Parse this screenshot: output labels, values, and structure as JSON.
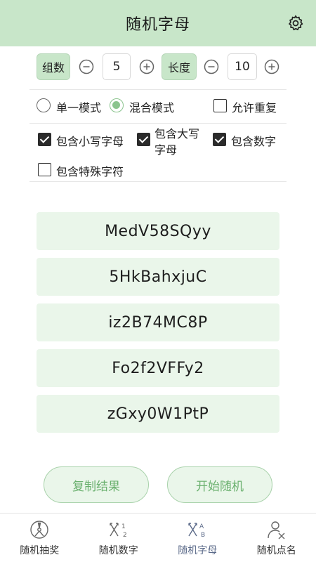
{
  "header": {
    "title": "随机字母",
    "settings_icon": "gear-icon"
  },
  "controls": {
    "groups_label": "组数",
    "groups_value": "5",
    "length_label": "长度",
    "length_value": "10",
    "minus_icon": "minus-circle-icon",
    "plus_icon": "plus-circle-icon"
  },
  "modes": [
    {
      "label": "单一模式",
      "selected": false
    },
    {
      "label": "混合模式",
      "selected": true
    }
  ],
  "allow_repeat": {
    "label": "允许重复",
    "checked": false
  },
  "options": [
    {
      "label": "包含小写字母",
      "checked": true
    },
    {
      "label_line1": "包含大写",
      "label_line2": "字母",
      "checked": true
    },
    {
      "label": "包含数字",
      "checked": true
    },
    {
      "label": "包含特殊字符",
      "checked": false
    }
  ],
  "results": [
    "MedV58SQyy",
    "5HkBahxjuC",
    "iz2B74MC8P",
    "Fo2f2VFFy2",
    "zGxy0W1PtP"
  ],
  "actions": {
    "copy_label": "复制结果",
    "start_label": "开始随机"
  },
  "tabs": [
    {
      "label": "随机抽奖",
      "icon": "wheel-icon",
      "active": false
    },
    {
      "label": "随机数字",
      "icon": "number-shuffle-icon",
      "active": false
    },
    {
      "label": "随机字母",
      "icon": "letter-shuffle-icon",
      "active": true
    },
    {
      "label": "随机点名",
      "icon": "person-pick-icon",
      "active": false
    }
  ],
  "colors": {
    "header_bg": "#c8e6c9",
    "accent": "#8bc48e",
    "result_bg": "#eaf6ea",
    "button_text": "#6ab06e",
    "active_tab": "#5c6b8a"
  }
}
